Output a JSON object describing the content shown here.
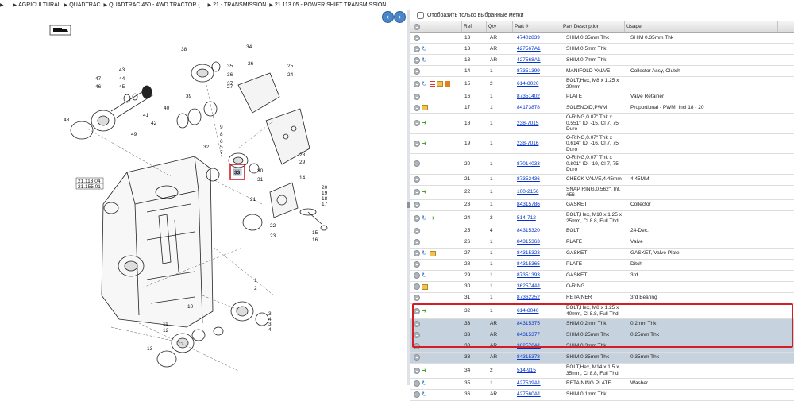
{
  "breadcrumb": {
    "items": [
      "...",
      "AGRICULTURAL",
      "QUADTRAC",
      "QUADTRAC 450 - 4WD TRACTOR (...",
      "21 - TRANSMISSION",
      "21.113.05 - POWER SHIFT TRANSMISSION ..."
    ]
  },
  "diagram": {
    "ref_labels": [
      "38",
      "34",
      "35",
      "36",
      "37",
      "26",
      "25",
      "24",
      "27",
      "43",
      "44",
      "45",
      "46",
      "47",
      "39",
      "41",
      "40",
      "42",
      "48",
      "49",
      "9",
      "8",
      "6",
      "5",
      "7",
      "28",
      "29",
      "30",
      "31",
      "32",
      "14",
      "33",
      "20",
      "19",
      "18",
      "17",
      "21",
      "22",
      "23",
      "15",
      "16",
      "10",
      "11",
      "12",
      "13",
      "1",
      "2",
      "3",
      "4",
      "3",
      "4"
    ],
    "note_labels": [
      "21.113.04",
      "21.155.01"
    ],
    "highlight_ref": "33"
  },
  "filter": {
    "label": "Отобразить только выбранные метки"
  },
  "table": {
    "headers": [
      "Ref",
      "Qty",
      "Part #",
      "Part Description",
      "Usage"
    ],
    "rows": [
      {
        "icons": "a",
        "ref": "13",
        "qty": "AR",
        "part": "47402839",
        "desc": "SHIM,0.35mm Thk",
        "usage": "SHIM 0.35mm Thk"
      },
      {
        "icons": "as",
        "ref": "13",
        "qty": "AR",
        "part": "427567A1",
        "desc": "SHIM,0.5mm Thk",
        "usage": ""
      },
      {
        "icons": "as",
        "ref": "13",
        "qty": "AR",
        "part": "427568A1",
        "desc": "SHIM,0.7mm Thk",
        "usage": ""
      },
      {
        "icons": "a",
        "ref": "14",
        "qty": "1",
        "part": "87351399",
        "desc": "MANIFOLD VALVE",
        "usage": "Collector Assy, Clutch"
      },
      {
        "icons": "aslnf",
        "ref": "15",
        "qty": "2",
        "part": "614-8020",
        "desc": "BOLT,Hex, M8 x 1.25 x 20mm",
        "usage": ""
      },
      {
        "icons": "a",
        "ref": "16",
        "qty": "1",
        "part": "87351402",
        "desc": "PLATE",
        "usage": "Valve Retainer"
      },
      {
        "icons": "an",
        "ref": "17",
        "qty": "1",
        "part": "84173878",
        "desc": "SOLENOID,PWM",
        "usage": "Proportional - PWM, Incl 18 - 20"
      },
      {
        "icons": "ag",
        "ref": "18",
        "qty": "1",
        "part": "238-7015",
        "desc": "O-RING,0.07\" Thk x 0.551\" ID, -15, Cl 7, 75 Duro",
        "usage": ""
      },
      {
        "icons": "ag",
        "ref": "19",
        "qty": "1",
        "part": "238-7016",
        "desc": "O-RING,0.07\" Thk x 0.614\" ID, -16, Cl 7, 75 Duro",
        "usage": ""
      },
      {
        "icons": "a",
        "ref": "20",
        "qty": "1",
        "part": "87014033",
        "desc": "O-RING,0.07\" Thk x 0.801\" ID, -19, Cl 7, 75 Duro",
        "usage": ""
      },
      {
        "icons": "a",
        "ref": "21",
        "qty": "1",
        "part": "87352436",
        "desc": "CHECK VALVE,4.45mm",
        "usage": "4.45MM"
      },
      {
        "icons": "ag",
        "ref": "22",
        "qty": "1",
        "part": "100-2156",
        "desc": "SNAP RING,0.562\", Int, #56",
        "usage": ""
      },
      {
        "icons": "a",
        "ref": "23",
        "qty": "1",
        "part": "84315786",
        "desc": "GASKET",
        "usage": "Collector"
      },
      {
        "icons": "asg",
        "ref": "24",
        "qty": "2",
        "part": "514-712",
        "desc": "BOLT,Hex, M10 x 1.25 x 25mm, Cl 8.8, Full Thd",
        "usage": ""
      },
      {
        "icons": "a",
        "ref": "25",
        "qty": "4",
        "part": "84315320",
        "desc": "BOLT",
        "usage": "24-Dec."
      },
      {
        "icons": "a",
        "ref": "26",
        "qty": "1",
        "part": "84315363",
        "desc": "PLATE",
        "usage": "Valve"
      },
      {
        "icons": "asn",
        "ref": "27",
        "qty": "1",
        "part": "84315323",
        "desc": "GASKET",
        "usage": "GASKET, Valve Plate"
      },
      {
        "icons": "a",
        "ref": "28",
        "qty": "1",
        "part": "84315365",
        "desc": "PLATE",
        "usage": "Ditch"
      },
      {
        "icons": "as",
        "ref": "29",
        "qty": "1",
        "part": "87351393",
        "desc": "GASKET",
        "usage": "3rd"
      },
      {
        "icons": "an",
        "ref": "30",
        "qty": "1",
        "part": "362574A1",
        "desc": "O-RING",
        "usage": ""
      },
      {
        "icons": "a",
        "ref": "31",
        "qty": "1",
        "part": "87362252",
        "desc": "RETAINER",
        "usage": "3rd Bearing"
      },
      {
        "icons": "ag",
        "ref": "32",
        "qty": "1",
        "part": "614-8040",
        "desc": "BOLT,Hex, M8 x 1.25 x 40mm, Cl 8.8, Full Thd",
        "usage": ""
      },
      {
        "icons": "a",
        "ref": "33",
        "qty": "AR",
        "part": "84315375",
        "desc": "SHIM,0.2mm Thk",
        "usage": "0.2mm Thk",
        "sel": true
      },
      {
        "icons": "a",
        "ref": "33",
        "qty": "AR",
        "part": "84315377",
        "desc": "SHIM,0.25mm Thk",
        "usage": "0.25mm Thk",
        "sel": true
      },
      {
        "icons": "a",
        "ref": "33",
        "qty": "AR",
        "part": "362576A1",
        "desc": "SHIM,0.3mm Thk",
        "usage": "",
        "sel": true
      },
      {
        "icons": "a",
        "ref": "33",
        "qty": "AR",
        "part": "84315378",
        "desc": "SHIM,0.35mm Thk",
        "usage": "0.35mm Thk",
        "sel": true
      },
      {
        "icons": "ag",
        "ref": "34",
        "qty": "2",
        "part": "514-915",
        "desc": "BOLT,Hex, M14 x 1.5 x 35mm, Cl 8.8, Full Thd",
        "usage": ""
      },
      {
        "icons": "as",
        "ref": "35",
        "qty": "1",
        "part": "427539A1",
        "desc": "RETAINING PLATE",
        "usage": "Washer"
      },
      {
        "icons": "as",
        "ref": "36",
        "qty": "AR",
        "part": "427560A1",
        "desc": "SHIM,0.1mm Thk",
        "usage": ""
      }
    ]
  },
  "colors": {
    "highlight": "#d21f26",
    "selected_row": "#c6d2dd",
    "link": "#0033cc",
    "nav_button": "#4a86c8"
  },
  "icons": {
    "a": "add-circle-icon",
    "s": "swap-icon",
    "g": "green-arrow-icon",
    "n": "note-icon",
    "l": "list-icon",
    "f": "flag-icon"
  }
}
